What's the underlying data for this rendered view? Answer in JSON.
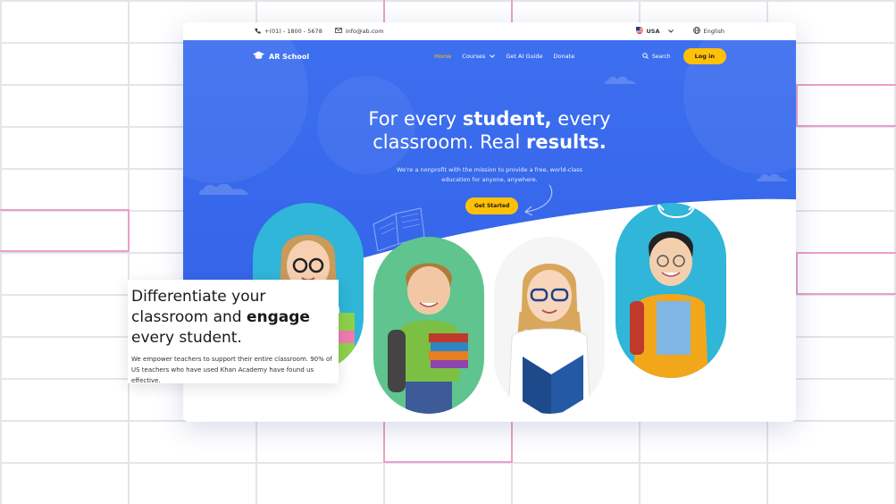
{
  "topbar": {
    "phone": "+(01) - 1800 - 5678",
    "email": "info@ab.com",
    "region": "USA",
    "language": "English"
  },
  "nav": {
    "brand": "AR School",
    "links": [
      {
        "label": "Home"
      },
      {
        "label": "Courses"
      },
      {
        "label": "Get AI Guide"
      },
      {
        "label": "Donate"
      }
    ],
    "search_label": "Search",
    "login_label": "Log in"
  },
  "hero": {
    "headline_line1_a": "For every ",
    "headline_line1_b": "student,",
    "headline_line1_c": " every",
    "headline_line2_a": "classroom. Real ",
    "headline_line2_b": "results.",
    "subtext": "We're a nonprofit with the mission to provide a free, world-class education for anyone, anywhere.",
    "cta_label": "Get Started"
  },
  "card": {
    "title_line1": "Differentiate your",
    "title_line2_a": "classroom and ",
    "title_line2_b": "engage",
    "title_line3": "every student.",
    "body": "We empower teachers to support their entire classroom. 90% of US teachers who have used Khan Academy have found us effective."
  },
  "colors": {
    "hero_blue": "#3d6ff0",
    "accent_yellow": "#ffc107",
    "active_link": "#ffc400"
  }
}
